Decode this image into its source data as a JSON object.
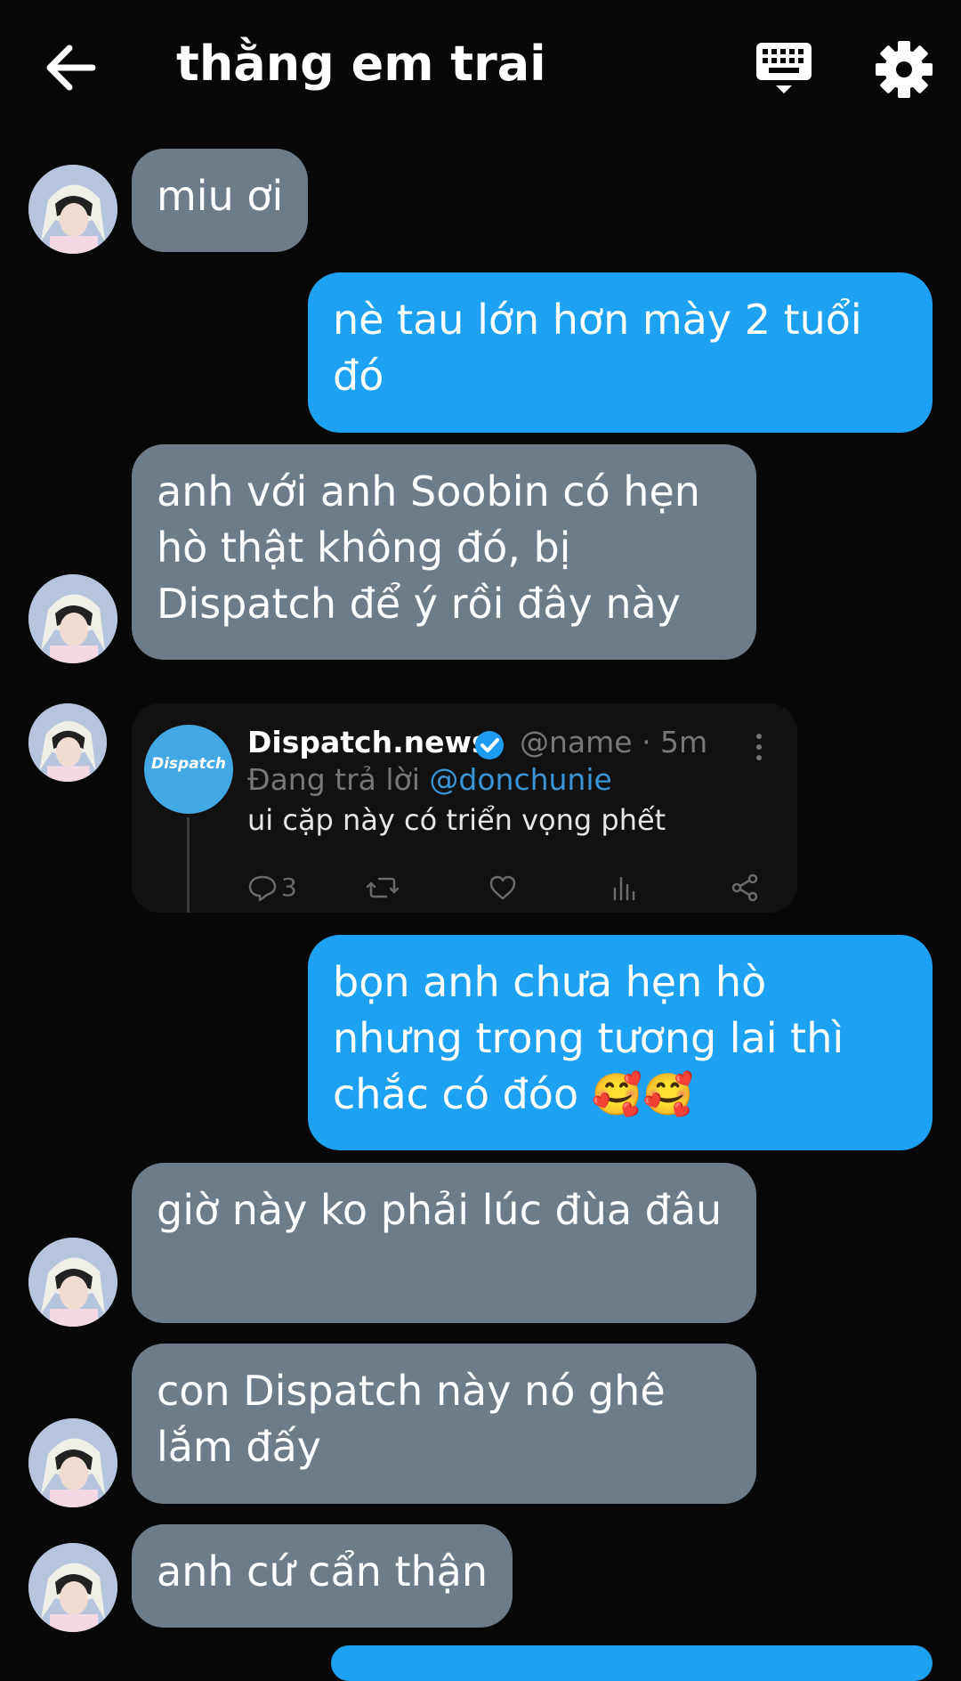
{
  "header": {
    "title": "thằng em trai"
  },
  "messages": [
    {
      "sender": "them",
      "text": "miu ơi"
    },
    {
      "sender": "me",
      "text": "nè tau lớn hơn mày 2 tuổi đó"
    },
    {
      "sender": "them",
      "text": "anh với anh Soobin có hẹn hò thật không đó, bị Dispatch để ý rồi đây này"
    },
    {
      "sender": "them",
      "type": "tweet"
    },
    {
      "sender": "me",
      "text": "bọn anh chưa hẹn hò nhưng trong tương lai thì chắc có đóo 🥰🥰"
    },
    {
      "sender": "them",
      "text": "giờ này ko phải lúc đùa đâu"
    },
    {
      "sender": "them",
      "text": "con Dispatch này nó ghê lắm đấy"
    },
    {
      "sender": "them",
      "text": "anh cứ cẩn thận"
    }
  ],
  "tweet": {
    "logo_text": "Dispatch",
    "name": "Dispatch.news",
    "handle_time": "@name · 5m",
    "reply_prefix": "Đang trả lời",
    "reply_handle": "@donchunie",
    "text": "ui cặp này có triển vọng phết",
    "reply_count": "3"
  },
  "colors": {
    "background": "#070707",
    "incoming_bubble": "#6e7c89",
    "outgoing_bubble": "#1da1f2",
    "tweet_background": "#111111",
    "mention": "#3a94d6"
  },
  "icons": [
    "back-arrow-icon",
    "keyboard-icon",
    "gear-icon",
    "verified-badge-icon",
    "more-options-icon",
    "reply-icon",
    "retweet-icon",
    "like-icon",
    "analytics-icon",
    "share-icon"
  ]
}
